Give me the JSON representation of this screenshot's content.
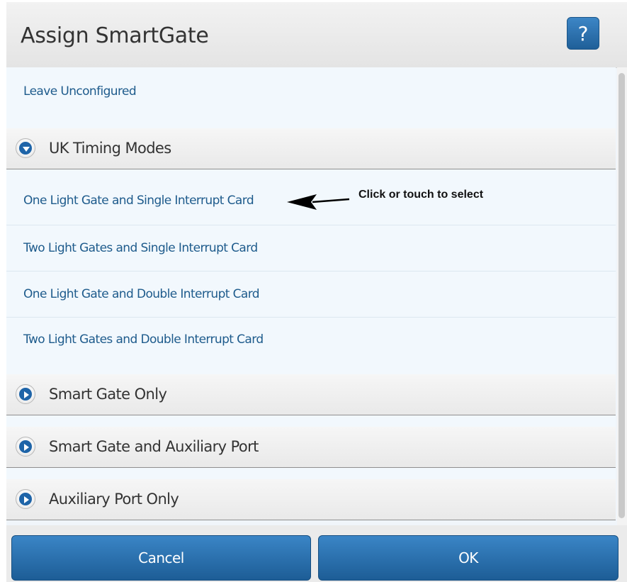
{
  "dialog": {
    "title": "Assign SmartGate",
    "help_label": "?"
  },
  "list": {
    "leave_unconfigured": "Leave Unconfigured",
    "groups": [
      {
        "label": "UK Timing Modes",
        "expanded": true,
        "icon": "chevron-down-circle-icon",
        "items": [
          "One Light Gate and Single Interrupt Card",
          "Two Light Gates and Single Interrupt Card",
          "One Light Gate and Double Interrupt Card",
          "Two Light Gates and Double Interrupt Card"
        ]
      },
      {
        "label": "Smart Gate Only",
        "expanded": false,
        "icon": "chevron-right-circle-icon"
      },
      {
        "label": "Smart Gate and Auxiliary Port",
        "expanded": false,
        "icon": "chevron-right-circle-icon"
      },
      {
        "label": "Auxiliary Port Only",
        "expanded": false,
        "icon": "chevron-right-circle-icon"
      }
    ]
  },
  "annotation": {
    "text": "Click or touch to select",
    "icon": "arrow-left-icon"
  },
  "footer": {
    "cancel_label": "Cancel",
    "ok_label": "OK"
  },
  "colors": {
    "accent": "#1e64a8",
    "button": "#2b72b2",
    "item_text": "#1e5b8c",
    "list_background": "#f2f8fd"
  }
}
